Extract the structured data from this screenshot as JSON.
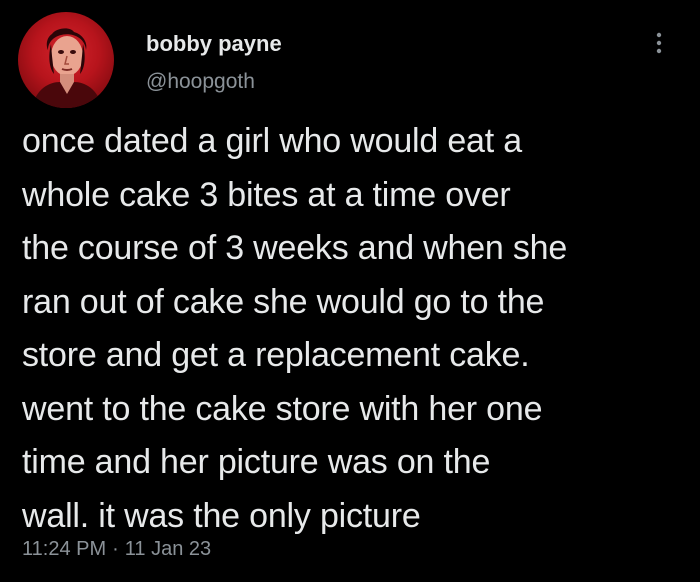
{
  "author": {
    "display_name": "bobby payne",
    "handle": "@hoopgoth"
  },
  "more_icon": "more-vertical-icon",
  "tweet": {
    "text": "once dated a girl who would eat a\nwhole cake 3 bites at a time over\nthe course of 3 weeks and when she\nran out of cake she would go to the\nstore and get a replacement cake.\nwent to the cake store with her one\ntime and her picture was on the\nwall. it was the only picture"
  },
  "meta": {
    "time": "11:24 PM",
    "separator": "·",
    "date": "11 Jan 23"
  },
  "colors": {
    "background": "#000000",
    "primary_text": "#e7e9ea",
    "secondary_text": "#8b9298",
    "avatar_red": "#c11a22"
  }
}
